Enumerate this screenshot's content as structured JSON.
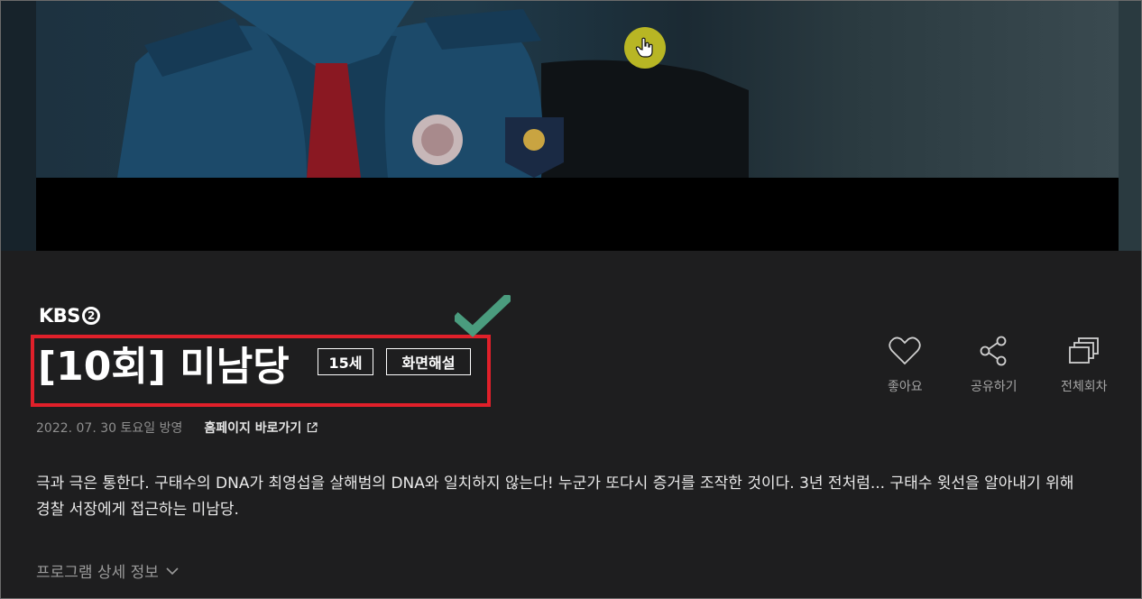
{
  "program": {
    "channel": "KBS",
    "title": "[10회] 미남당",
    "badges": {
      "age": "15세",
      "audio_description": "화면해설"
    },
    "air_date": "2022. 07. 30 토요일 방영",
    "homepage_link": "홈페이지 바로가기",
    "description": "극과 극은 통한다. 구태수의 DNA가 최영섭을 살해범의 DNA와 일치하지 않는다! 누군가 또다시 증거를 조작한 것이다. 3년 전처럼... 구태수 윗선을 알아내기 위해 경찰 서장에게 접근하는 미남당.",
    "details_toggle": "프로그램 상세 정보"
  },
  "actions": {
    "like": "좋아요",
    "share": "공유하기",
    "all_episodes": "전체회차"
  },
  "colors": {
    "background": "#1e1e1f",
    "highlight_box": "#e0202a",
    "checkmark": "#4a9c7e",
    "cursor_highlight": "#b8b624"
  }
}
